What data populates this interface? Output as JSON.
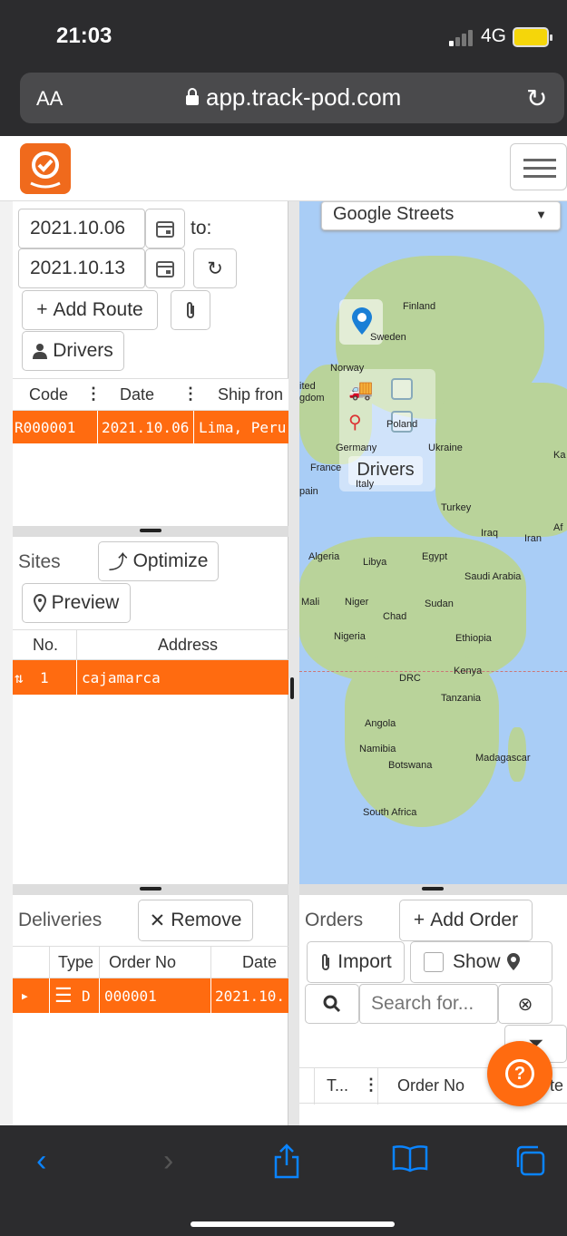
{
  "status": {
    "time": "21:03",
    "network": "4G"
  },
  "browser": {
    "aa": "AA",
    "url": "app.track-pod.com"
  },
  "routes": {
    "date_from": "2021.10.06",
    "to_label": "to:",
    "date_to": "2021.10.13",
    "add_route": "Add Route",
    "drivers": "Drivers",
    "columns": [
      "Code",
      "Date",
      "Ship fron"
    ],
    "rows": [
      {
        "code": "R000001",
        "date": "2021.10.06",
        "ship_from": "Lima, Peru"
      }
    ]
  },
  "sites": {
    "label": "Sites",
    "optimize": "Optimize",
    "preview": "Preview",
    "columns": [
      "No.",
      "Address"
    ],
    "rows": [
      {
        "no": "1",
        "address": "cajamarca"
      }
    ]
  },
  "deliveries": {
    "label": "Deliveries",
    "remove": "Remove",
    "columns": [
      "Type",
      "Order No",
      "Date"
    ],
    "rows": [
      {
        "type": "D",
        "order_no": "000001",
        "date": "2021.10.("
      }
    ]
  },
  "orders": {
    "label": "Orders",
    "add_order": "Add Order",
    "import": "Import",
    "show": "Show",
    "search_placeholder": "Search for...",
    "columns": [
      "T...",
      "Order No",
      "te"
    ]
  },
  "map": {
    "layer_select": "Google Streets",
    "drivers_label": "Drivers",
    "labels": [
      "Finland",
      "Sweden",
      "Norway",
      "ited",
      "gdom",
      "Poland",
      "Germany",
      "Ukraine",
      "Ka",
      "France",
      "Italy",
      "pain",
      "Turkey",
      "Iraq",
      "Iran",
      "Af",
      "Algeria",
      "Libya",
      "Egypt",
      "Saudi Arabia",
      "Mali",
      "Niger",
      "Chad",
      "Sudan",
      "Nigeria",
      "Ethiopia",
      "DRC",
      "Kenya",
      "Tanzania",
      "Angola",
      "Namibia",
      "Botswana",
      "Madagascar",
      "South Africa"
    ]
  },
  "help": {
    "icon": "?"
  },
  "colors": {
    "accent": "#ff6b10",
    "map_water": "#a9cdf6",
    "map_land": "#b9d39a"
  }
}
